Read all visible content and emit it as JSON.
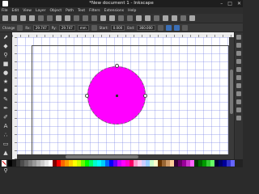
{
  "window": {
    "title": "*New document 1 - Inkscape"
  },
  "menu": [
    "File",
    "Edit",
    "View",
    "Layer",
    "Object",
    "Path",
    "Text",
    "Filters",
    "Extensions",
    "Help"
  ],
  "control_bar": {
    "mode_label": "Change",
    "rx_label": "Rx:",
    "rx_value": "29.747",
    "ry_label": "Ry:",
    "ry_value": "29.747",
    "unit": "mm",
    "start_label": "Start:",
    "start_value": "0.000",
    "end_label": "End:",
    "end_value": "360.000"
  },
  "canvas": {
    "fill_color": "#ff00ff",
    "shape": "circle"
  },
  "palette_colors": [
    "#000000",
    "#1a1a1a",
    "#333333",
    "#4d4d4d",
    "#666666",
    "#808080",
    "#999999",
    "#b3b3b3",
    "#cccccc",
    "#e6e6e6",
    "#ffffff",
    "#800000",
    "#ff0000",
    "#ff6600",
    "#ff9900",
    "#ffcc00",
    "#ffff00",
    "#ccff00",
    "#66ff00",
    "#00ff00",
    "#00ff66",
    "#00ffcc",
    "#00ffff",
    "#00ccff",
    "#0066ff",
    "#0000ff",
    "#6600ff",
    "#cc00ff",
    "#ff00ff",
    "#ff00cc",
    "#ff0066",
    "#ff99cc",
    "#ffccee",
    "#ccccff",
    "#99ccff",
    "#ccffcc",
    "#ffffcc",
    "#663300",
    "#996633",
    "#cc9966",
    "#ffcc99",
    "#330033",
    "#660066",
    "#990099",
    "#cc33cc",
    "#ff66ff",
    "#003300",
    "#006600",
    "#009900",
    "#33cc33",
    "#66ff66",
    "#000033",
    "#000066",
    "#000099",
    "#3333cc",
    "#6666ff"
  ]
}
